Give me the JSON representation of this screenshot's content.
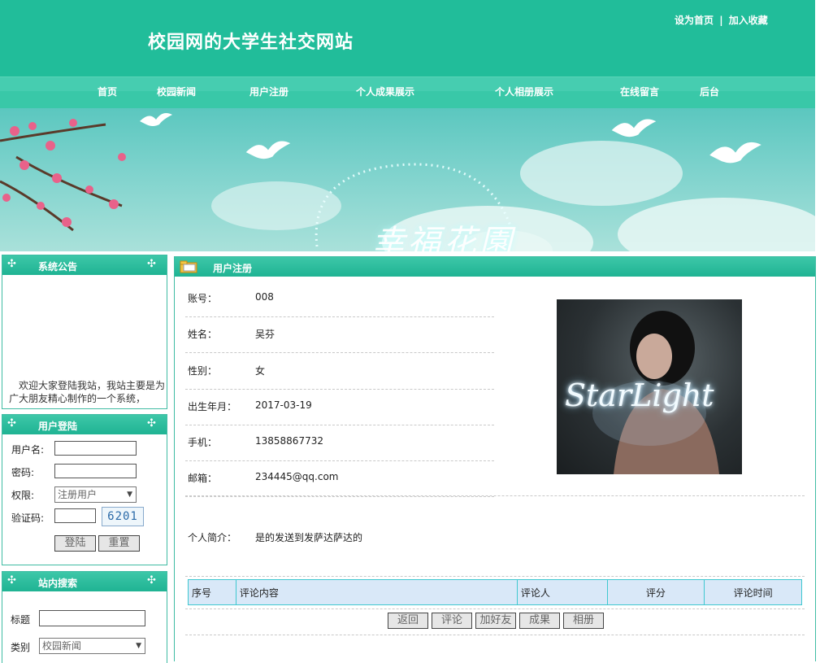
{
  "header": {
    "site_title": "校园网的大学生社交网站",
    "set_home": "设为首页",
    "separator": "|",
    "add_favorite": "加入收藏"
  },
  "nav": {
    "items": [
      "首页",
      "校园新闻",
      "用户注册",
      "个人成果展示",
      "个人相册展示",
      "在线留言",
      "后台"
    ]
  },
  "banner": {
    "text": "幸福花園"
  },
  "sidebar": {
    "notice": {
      "title": "系统公告",
      "text": "欢迎大家登陆我站，我站主要是为广大朋友精心制作的一个系统，"
    },
    "login": {
      "title": "用户登陆",
      "username_label": "用户名:",
      "password_label": "密码:",
      "role_label": "权限:",
      "role_value": "注册用户",
      "captcha_label": "验证码:",
      "captcha_code": "6201",
      "login_button": "登陆",
      "reset_button": "重置"
    },
    "search": {
      "title": "站内搜索",
      "title_label": "标题",
      "category_label": "类别",
      "category_value": "校园新闻"
    }
  },
  "main": {
    "title": "用户注册",
    "fields": [
      {
        "label": "账号：",
        "value": "008"
      },
      {
        "label": "姓名：",
        "value": "吴芬"
      },
      {
        "label": "性别：",
        "value": "女"
      },
      {
        "label": "出生年月：",
        "value": "2017-03-19"
      },
      {
        "label": "手机：",
        "value": "13858867732"
      },
      {
        "label": "邮箱：",
        "value": "234445@qq.com"
      }
    ],
    "intro": {
      "label": "个人简介：",
      "value": "是的发送到发萨达萨达的"
    },
    "photo_text": "StarLight",
    "comments": {
      "headers": [
        "序号",
        "评论内容",
        "评论人",
        "评分",
        "评论时间"
      ]
    },
    "buttons": [
      "返回",
      "评论",
      "加好友",
      "成果",
      "相册"
    ]
  },
  "colors": {
    "header_green": "#21bd9a",
    "nav_green": "#39c8a8",
    "panel_border": "#3fbca3",
    "table_header_bg": "#d9e8f8",
    "table_border": "#3fc8d0"
  }
}
